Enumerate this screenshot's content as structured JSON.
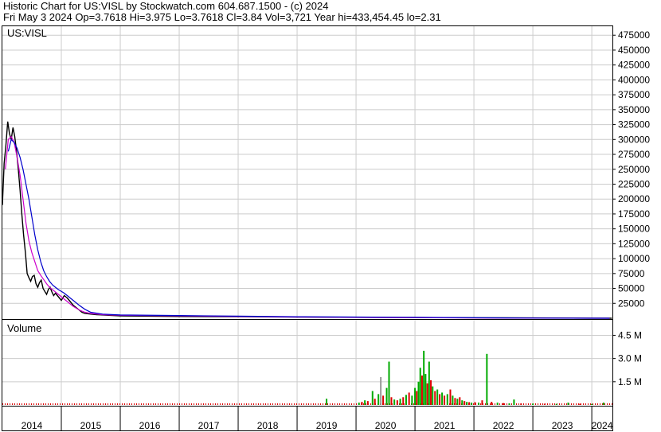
{
  "header": {
    "line1": "Historic Chart for US:VISL by Stockwatch.com 604.687.1500 - (c) 2024",
    "line2": "Fri May  3 2024   Op=3.7618   Hi=3.975   Lo=3.7618   Cl=3.84   Vol=3,721   Year hi=433,454.45   lo=2.31"
  },
  "chart_data": [
    {
      "type": "line",
      "title": "US:VISL",
      "y_ticks": [
        475000,
        450000,
        425000,
        400000,
        375000,
        350000,
        325000,
        300000,
        275000,
        250000,
        225000,
        200000,
        175000,
        150000,
        125000,
        100000,
        75000,
        50000,
        25000
      ],
      "ylim": [
        0,
        490000
      ],
      "x_tick_labels": [
        "2014",
        "2015",
        "2016",
        "2017",
        "2018",
        "2019",
        "2020",
        "2021",
        "2022",
        "2023",
        "2024"
      ],
      "xlim": [
        2014.0,
        2024.35
      ],
      "grid": true,
      "series": [
        {
          "role": "price",
          "color": "#000000",
          "x": [
            2014.0,
            2014.03,
            2014.06,
            2014.09,
            2014.12,
            2014.15,
            2014.18,
            2014.21,
            2014.24,
            2014.27,
            2014.3,
            2014.33,
            2014.36,
            2014.39,
            2014.42,
            2014.45,
            2014.48,
            2014.51,
            2014.54,
            2014.57,
            2014.6,
            2014.63,
            2014.66,
            2014.69,
            2014.72,
            2014.75,
            2014.78,
            2014.81,
            2014.84,
            2014.87,
            2014.9,
            2014.95,
            2015.0,
            2015.05,
            2015.1,
            2015.15,
            2015.2,
            2015.25,
            2015.3,
            2015.35,
            2015.4,
            2015.5,
            2015.6,
            2015.8,
            2016.0,
            2016.5,
            2017.0,
            2018.0,
            2019.0,
            2020.0,
            2021.0,
            2022.0,
            2023.0,
            2024.0,
            2024.34
          ],
          "y": [
            190000,
            260000,
            290000,
            330000,
            310000,
            300000,
            320000,
            305000,
            280000,
            250000,
            215000,
            175000,
            140000,
            110000,
            75000,
            68000,
            62000,
            70000,
            72000,
            58000,
            52000,
            60000,
            64000,
            50000,
            45000,
            40000,
            48000,
            52000,
            44000,
            38000,
            42000,
            36000,
            30000,
            38000,
            34000,
            28000,
            22000,
            18000,
            14000,
            10000,
            8000,
            7000,
            6000,
            5000,
            4000,
            3500,
            3000,
            2500,
            2000,
            1500,
            1200,
            800,
            500,
            100,
            4
          ]
        },
        {
          "role": "moving-average-short",
          "color": "#cc00cc",
          "x": [
            2014.05,
            2014.1,
            2014.15,
            2014.2,
            2014.25,
            2014.3,
            2014.35,
            2014.4,
            2014.45,
            2014.5,
            2014.55,
            2014.6,
            2014.65,
            2014.7,
            2014.75,
            2014.8,
            2014.85,
            2014.9,
            2014.95,
            2015.0,
            2015.05,
            2015.1,
            2015.15,
            2015.2,
            2015.3,
            2015.4,
            2015.5,
            2015.7,
            2016.0,
            2017.0,
            2018.0,
            2019.0,
            2020.0,
            2021.0,
            2022.0,
            2023.0,
            2024.3
          ],
          "y": [
            250000,
            300000,
            305000,
            295000,
            270000,
            240000,
            200000,
            160000,
            130000,
            110000,
            95000,
            80000,
            72000,
            65000,
            58000,
            52000,
            48000,
            44000,
            40000,
            36000,
            32000,
            28000,
            24000,
            20000,
            14000,
            10000,
            8000,
            6000,
            5000,
            4000,
            3000,
            2000,
            1500,
            1000,
            500,
            200,
            10
          ]
        },
        {
          "role": "moving-average-long",
          "color": "#0000cc",
          "x": [
            2014.1,
            2014.15,
            2014.2,
            2014.25,
            2014.3,
            2014.35,
            2014.4,
            2014.45,
            2014.5,
            2014.55,
            2014.6,
            2014.65,
            2014.7,
            2014.75,
            2014.8,
            2014.85,
            2014.9,
            2014.95,
            2015.0,
            2015.05,
            2015.1,
            2015.15,
            2015.2,
            2015.3,
            2015.4,
            2015.5,
            2015.7,
            2016.0,
            2017.0,
            2018.0,
            2019.0,
            2020.0,
            2021.0,
            2022.0,
            2023.0,
            2024.3
          ],
          "y": [
            280000,
            300000,
            295000,
            285000,
            270000,
            250000,
            225000,
            200000,
            170000,
            140000,
            115000,
            95000,
            80000,
            70000,
            62000,
            56000,
            52000,
            48000,
            45000,
            42000,
            38000,
            34000,
            30000,
            22000,
            15000,
            10000,
            7000,
            5500,
            4500,
            3500,
            2500,
            2000,
            1500,
            800,
            300,
            20
          ]
        }
      ]
    },
    {
      "type": "bar",
      "title": "Volume",
      "y_ticks": [
        4500000,
        3000000,
        1500000
      ],
      "y_tick_labels": [
        "4.5 M",
        "3.0 M",
        "1.5 M"
      ],
      "ylim": [
        0,
        5500000
      ],
      "xlim": [
        2014.0,
        2024.35
      ],
      "grid": true,
      "bars": [
        {
          "x": 2019.5,
          "v": 400000,
          "c": "#00aa00"
        },
        {
          "x": 2020.05,
          "v": 150000,
          "c": "#00aa00"
        },
        {
          "x": 2020.1,
          "v": 200000,
          "c": "#dd0000"
        },
        {
          "x": 2020.15,
          "v": 300000,
          "c": "#00aa00"
        },
        {
          "x": 2020.2,
          "v": 250000,
          "c": "#dd0000"
        },
        {
          "x": 2020.28,
          "v": 900000,
          "c": "#00aa00"
        },
        {
          "x": 2020.32,
          "v": 400000,
          "c": "#dd0000"
        },
        {
          "x": 2020.38,
          "v": 700000,
          "c": "#00aa00"
        },
        {
          "x": 2020.42,
          "v": 1800000,
          "c": "#999999"
        },
        {
          "x": 2020.46,
          "v": 600000,
          "c": "#dd0000"
        },
        {
          "x": 2020.52,
          "v": 1100000,
          "c": "#00aa00"
        },
        {
          "x": 2020.56,
          "v": 2800000,
          "c": "#00aa00"
        },
        {
          "x": 2020.6,
          "v": 500000,
          "c": "#dd0000"
        },
        {
          "x": 2020.65,
          "v": 350000,
          "c": "#00aa00"
        },
        {
          "x": 2020.7,
          "v": 300000,
          "c": "#dd0000"
        },
        {
          "x": 2020.75,
          "v": 400000,
          "c": "#00aa00"
        },
        {
          "x": 2020.8,
          "v": 500000,
          "c": "#dd0000"
        },
        {
          "x": 2020.85,
          "v": 650000,
          "c": "#00aa00"
        },
        {
          "x": 2020.9,
          "v": 800000,
          "c": "#dd0000"
        },
        {
          "x": 2020.95,
          "v": 600000,
          "c": "#00aa00"
        },
        {
          "x": 2021.0,
          "v": 1100000,
          "c": "#00aa00"
        },
        {
          "x": 2021.03,
          "v": 900000,
          "c": "#dd0000"
        },
        {
          "x": 2021.06,
          "v": 1500000,
          "c": "#00aa00"
        },
        {
          "x": 2021.09,
          "v": 2400000,
          "c": "#00aa00"
        },
        {
          "x": 2021.12,
          "v": 1900000,
          "c": "#dd0000"
        },
        {
          "x": 2021.15,
          "v": 3500000,
          "c": "#00aa00"
        },
        {
          "x": 2021.18,
          "v": 2000000,
          "c": "#00aa00"
        },
        {
          "x": 2021.21,
          "v": 1400000,
          "c": "#dd0000"
        },
        {
          "x": 2021.24,
          "v": 2800000,
          "c": "#00aa00"
        },
        {
          "x": 2021.27,
          "v": 1600000,
          "c": "#dd0000"
        },
        {
          "x": 2021.3,
          "v": 1200000,
          "c": "#00aa00"
        },
        {
          "x": 2021.34,
          "v": 900000,
          "c": "#dd0000"
        },
        {
          "x": 2021.38,
          "v": 1000000,
          "c": "#00aa00"
        },
        {
          "x": 2021.42,
          "v": 700000,
          "c": "#dd0000"
        },
        {
          "x": 2021.46,
          "v": 800000,
          "c": "#00aa00"
        },
        {
          "x": 2021.5,
          "v": 600000,
          "c": "#dd0000"
        },
        {
          "x": 2021.55,
          "v": 700000,
          "c": "#00aa00"
        },
        {
          "x": 2021.6,
          "v": 1000000,
          "c": "#dd0000"
        },
        {
          "x": 2021.64,
          "v": 600000,
          "c": "#00aa00"
        },
        {
          "x": 2021.68,
          "v": 450000,
          "c": "#dd0000"
        },
        {
          "x": 2021.72,
          "v": 400000,
          "c": "#00aa00"
        },
        {
          "x": 2021.76,
          "v": 500000,
          "c": "#dd0000"
        },
        {
          "x": 2021.8,
          "v": 300000,
          "c": "#00aa00"
        },
        {
          "x": 2021.84,
          "v": 250000,
          "c": "#dd0000"
        },
        {
          "x": 2021.88,
          "v": 200000,
          "c": "#00aa00"
        },
        {
          "x": 2021.92,
          "v": 180000,
          "c": "#dd0000"
        },
        {
          "x": 2021.96,
          "v": 150000,
          "c": "#00aa00"
        },
        {
          "x": 2022.02,
          "v": 180000,
          "c": "#dd0000"
        },
        {
          "x": 2022.08,
          "v": 150000,
          "c": "#00aa00"
        },
        {
          "x": 2022.14,
          "v": 300000,
          "c": "#dd0000"
        },
        {
          "x": 2022.22,
          "v": 3300000,
          "c": "#00aa00"
        },
        {
          "x": 2022.3,
          "v": 200000,
          "c": "#dd0000"
        },
        {
          "x": 2022.4,
          "v": 150000,
          "c": "#00aa00"
        },
        {
          "x": 2022.5,
          "v": 120000,
          "c": "#dd0000"
        },
        {
          "x": 2022.6,
          "v": 100000,
          "c": "#00aa00"
        },
        {
          "x": 2022.68,
          "v": 350000,
          "c": "#00aa00"
        },
        {
          "x": 2022.8,
          "v": 100000,
          "c": "#dd0000"
        },
        {
          "x": 2023.0,
          "v": 90000,
          "c": "#00aa00"
        },
        {
          "x": 2023.2,
          "v": 80000,
          "c": "#dd0000"
        },
        {
          "x": 2023.4,
          "v": 70000,
          "c": "#00aa00"
        },
        {
          "x": 2023.6,
          "v": 150000,
          "c": "#00aa00"
        },
        {
          "x": 2023.8,
          "v": 80000,
          "c": "#dd0000"
        },
        {
          "x": 2024.0,
          "v": 70000,
          "c": "#00aa00"
        },
        {
          "x": 2024.2,
          "v": 150000,
          "c": "#00aa00"
        }
      ]
    }
  ]
}
